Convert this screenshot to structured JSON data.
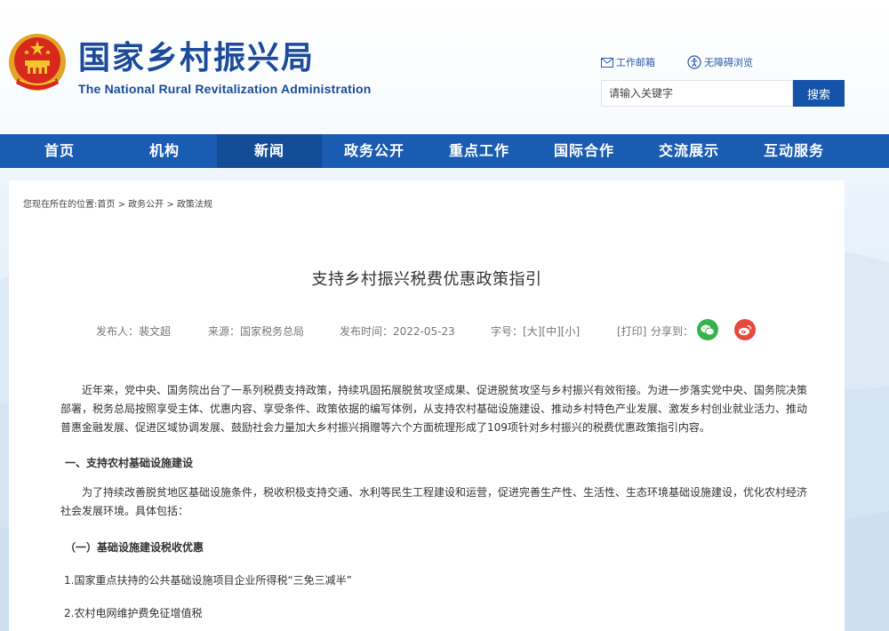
{
  "header": {
    "title_cn": "国家乡村振兴局",
    "title_en": "The National Rural Revitalization Administration",
    "links": [
      {
        "label": "工作邮箱",
        "icon": "mail-icon"
      },
      {
        "label": "无障碍浏览",
        "icon": "accessibility-icon"
      }
    ],
    "search": {
      "placeholder": "请输入关键字",
      "button_label": "搜索"
    }
  },
  "nav": {
    "items": [
      "首页",
      "机构",
      "新闻",
      "政务公开",
      "重点工作",
      "国际合作",
      "交流展示",
      "互动服务"
    ],
    "active_index": 2
  },
  "breadcrumb": {
    "prefix": "您现在所在的位置:",
    "items": [
      "首页",
      "政务公开",
      "政策法规"
    ],
    "separator": ">"
  },
  "article": {
    "title": "支持乡村振兴税费优惠政策指引",
    "meta": {
      "publisher": "发布人：裴文超",
      "source": "来源：国家税务总局",
      "date": "发布时间：2022-05-23",
      "font_size_label": "字号：",
      "sizes": [
        "[大]",
        "[中]",
        "[小]"
      ],
      "print": "[打印]",
      "share_label": "分享到："
    },
    "share_icons": [
      "wechat-icon",
      "weibo-icon"
    ],
    "paragraph1": "近年来，党中央、国务院出台了一系列税费支持政策，持续巩固拓展脱贫攻坚成果、促进脱贫攻坚与乡村振兴有效衔接。为进一步落实党中央、国务院决策部署，税务总局按照享受主体、优惠内容、享受条件、政策依据的编写体例，从支持农村基础设施建设、推动乡村特色产业发展、激发乡村创业就业活力、推动普惠金融发展、促进区域协调发展、鼓励社会力量加大乡村振兴捐赠等六个方面梳理形成了109项针对乡村振兴的税费优惠政策指引内容。",
    "heading1": "一、支持农村基础设施建设",
    "paragraph2": "为了持续改善脱贫地区基础设施条件，税收积极支持交通、水利等民生工程建设和运营，促进完善生产性、生活性、生态环境基础设施建设，优化农村经济社会发展环境。具体包括：",
    "heading2": "（一）基础设施建设税收优惠",
    "item1": "1.国家重点扶持的公共基础设施项目企业所得税“三免三减半”",
    "item2": "2.农村电网维护费免征增值税"
  },
  "colors": {
    "brand_blue": "#1b4b9a",
    "nav_blue": "#1a5cb1",
    "nav_active": "#134d97",
    "wechat_green": "#36b34a",
    "weibo_red": "#e8493e"
  }
}
